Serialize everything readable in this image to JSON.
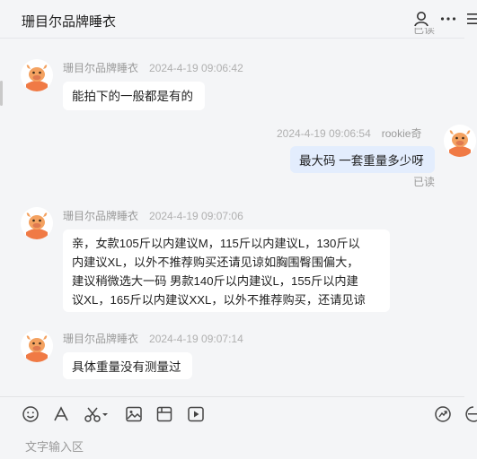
{
  "header": {
    "title": "珊目尔品牌睡衣",
    "partial_read_label": "已读"
  },
  "messages": [
    {
      "sender": "珊目尔品牌睡衣",
      "time": "2024-4-19 09:06:42",
      "text": "能拍下的一般都是有的"
    },
    {
      "sender": "rookie奇",
      "time": "2024-4-19 09:06:54",
      "text": "最大码  一套重量多少呀",
      "status": "已读"
    },
    {
      "sender": "珊目尔品牌睡衣",
      "time": "2024-4-19 09:07:06",
      "lines": [
        "亲，女款105斤以内建议M，115斤以内建议L，130斤以",
        "内建议XL，以外不推荐购买还请见谅如胸围臀围偏大，",
        "建议稍微选大一码 男款140斤以内建议L，155斤以内建",
        "议XL，165斤以内建议XXL，以外不推荐购买，还请见谅"
      ]
    },
    {
      "sender": "珊目尔品牌睡衣",
      "time": "2024-4-19 09:07:14",
      "text": "具体重量没有测量过"
    }
  ],
  "input": {
    "placeholder": "文字输入区"
  },
  "icons": {
    "header": [
      "user-icon",
      "more-icon",
      "menu-icon"
    ],
    "toolbar": [
      "emoji-icon",
      "font-icon",
      "scissors-icon",
      "image-icon",
      "file-icon",
      "video-icon",
      "quick-reply-icon",
      "chat-icon"
    ]
  }
}
